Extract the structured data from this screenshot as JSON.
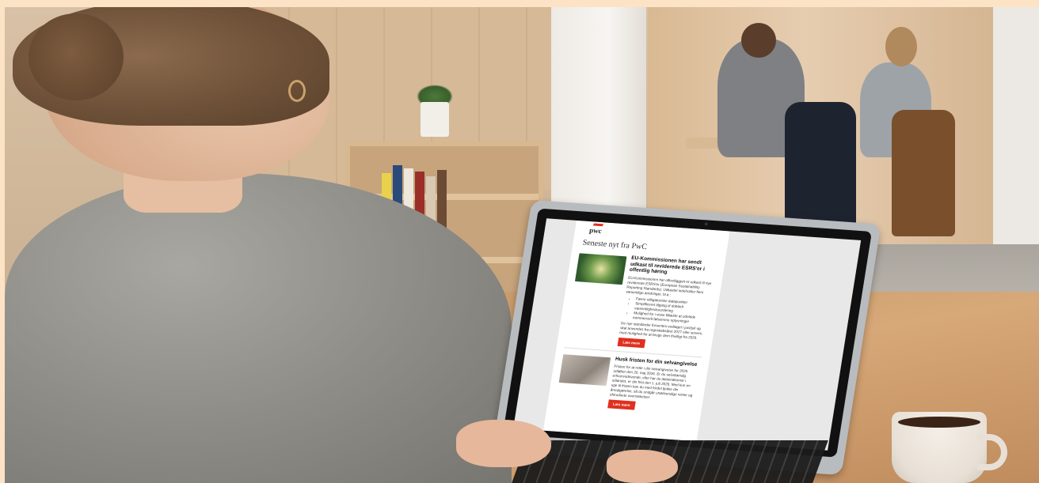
{
  "email": {
    "logo": "pwc",
    "headline": "Seneste nyt fra PwC",
    "articles": [
      {
        "title": "EU-Kommissionen har sendt udkast til reviderede ESRS'er i offentlig høring",
        "intro": "EU-Kommissionen har offentliggjort et udkast til nye reviderede ESRS'er (European Sustainability Reporting Standards). Udkastet indeholder flere væsentlige ændringer, bl.a.:",
        "bullets": [
          "Færre obligatoriske datapunkter",
          "Simplificeret tilgang til dobbelt væsentlighedsvurdering",
          "Mulighed for i visse tilfælde at udelade kommercielt følsomme oplysninger"
        ],
        "outro": "De nye standarder forventes vedtaget i juni/juli og skal anvendes fra regnskabsåret 2027 eller senere, med mulighed for at bruge dem frivilligt fra 2026.",
        "cta": "Læs mere"
      },
      {
        "title": "Husk fristen for din selvangivelse",
        "intro": "Fristen for at rette i din selvangivelse for 2025 udløber den 20. maj 2026. Er du selvstændig erhvervsdrivende, eller har du aktieindkomst i udlandet, er din frist den 1. juli 2026. Med kun en uge til fristen kan du med fordel tjekke din årsopgørelse, så du undgår unødvendige renter og uforudsete overraskelser.",
        "cta": "Læs mere"
      }
    ]
  },
  "colors": {
    "accent": "#e0301e",
    "border": "#fde3c5"
  }
}
